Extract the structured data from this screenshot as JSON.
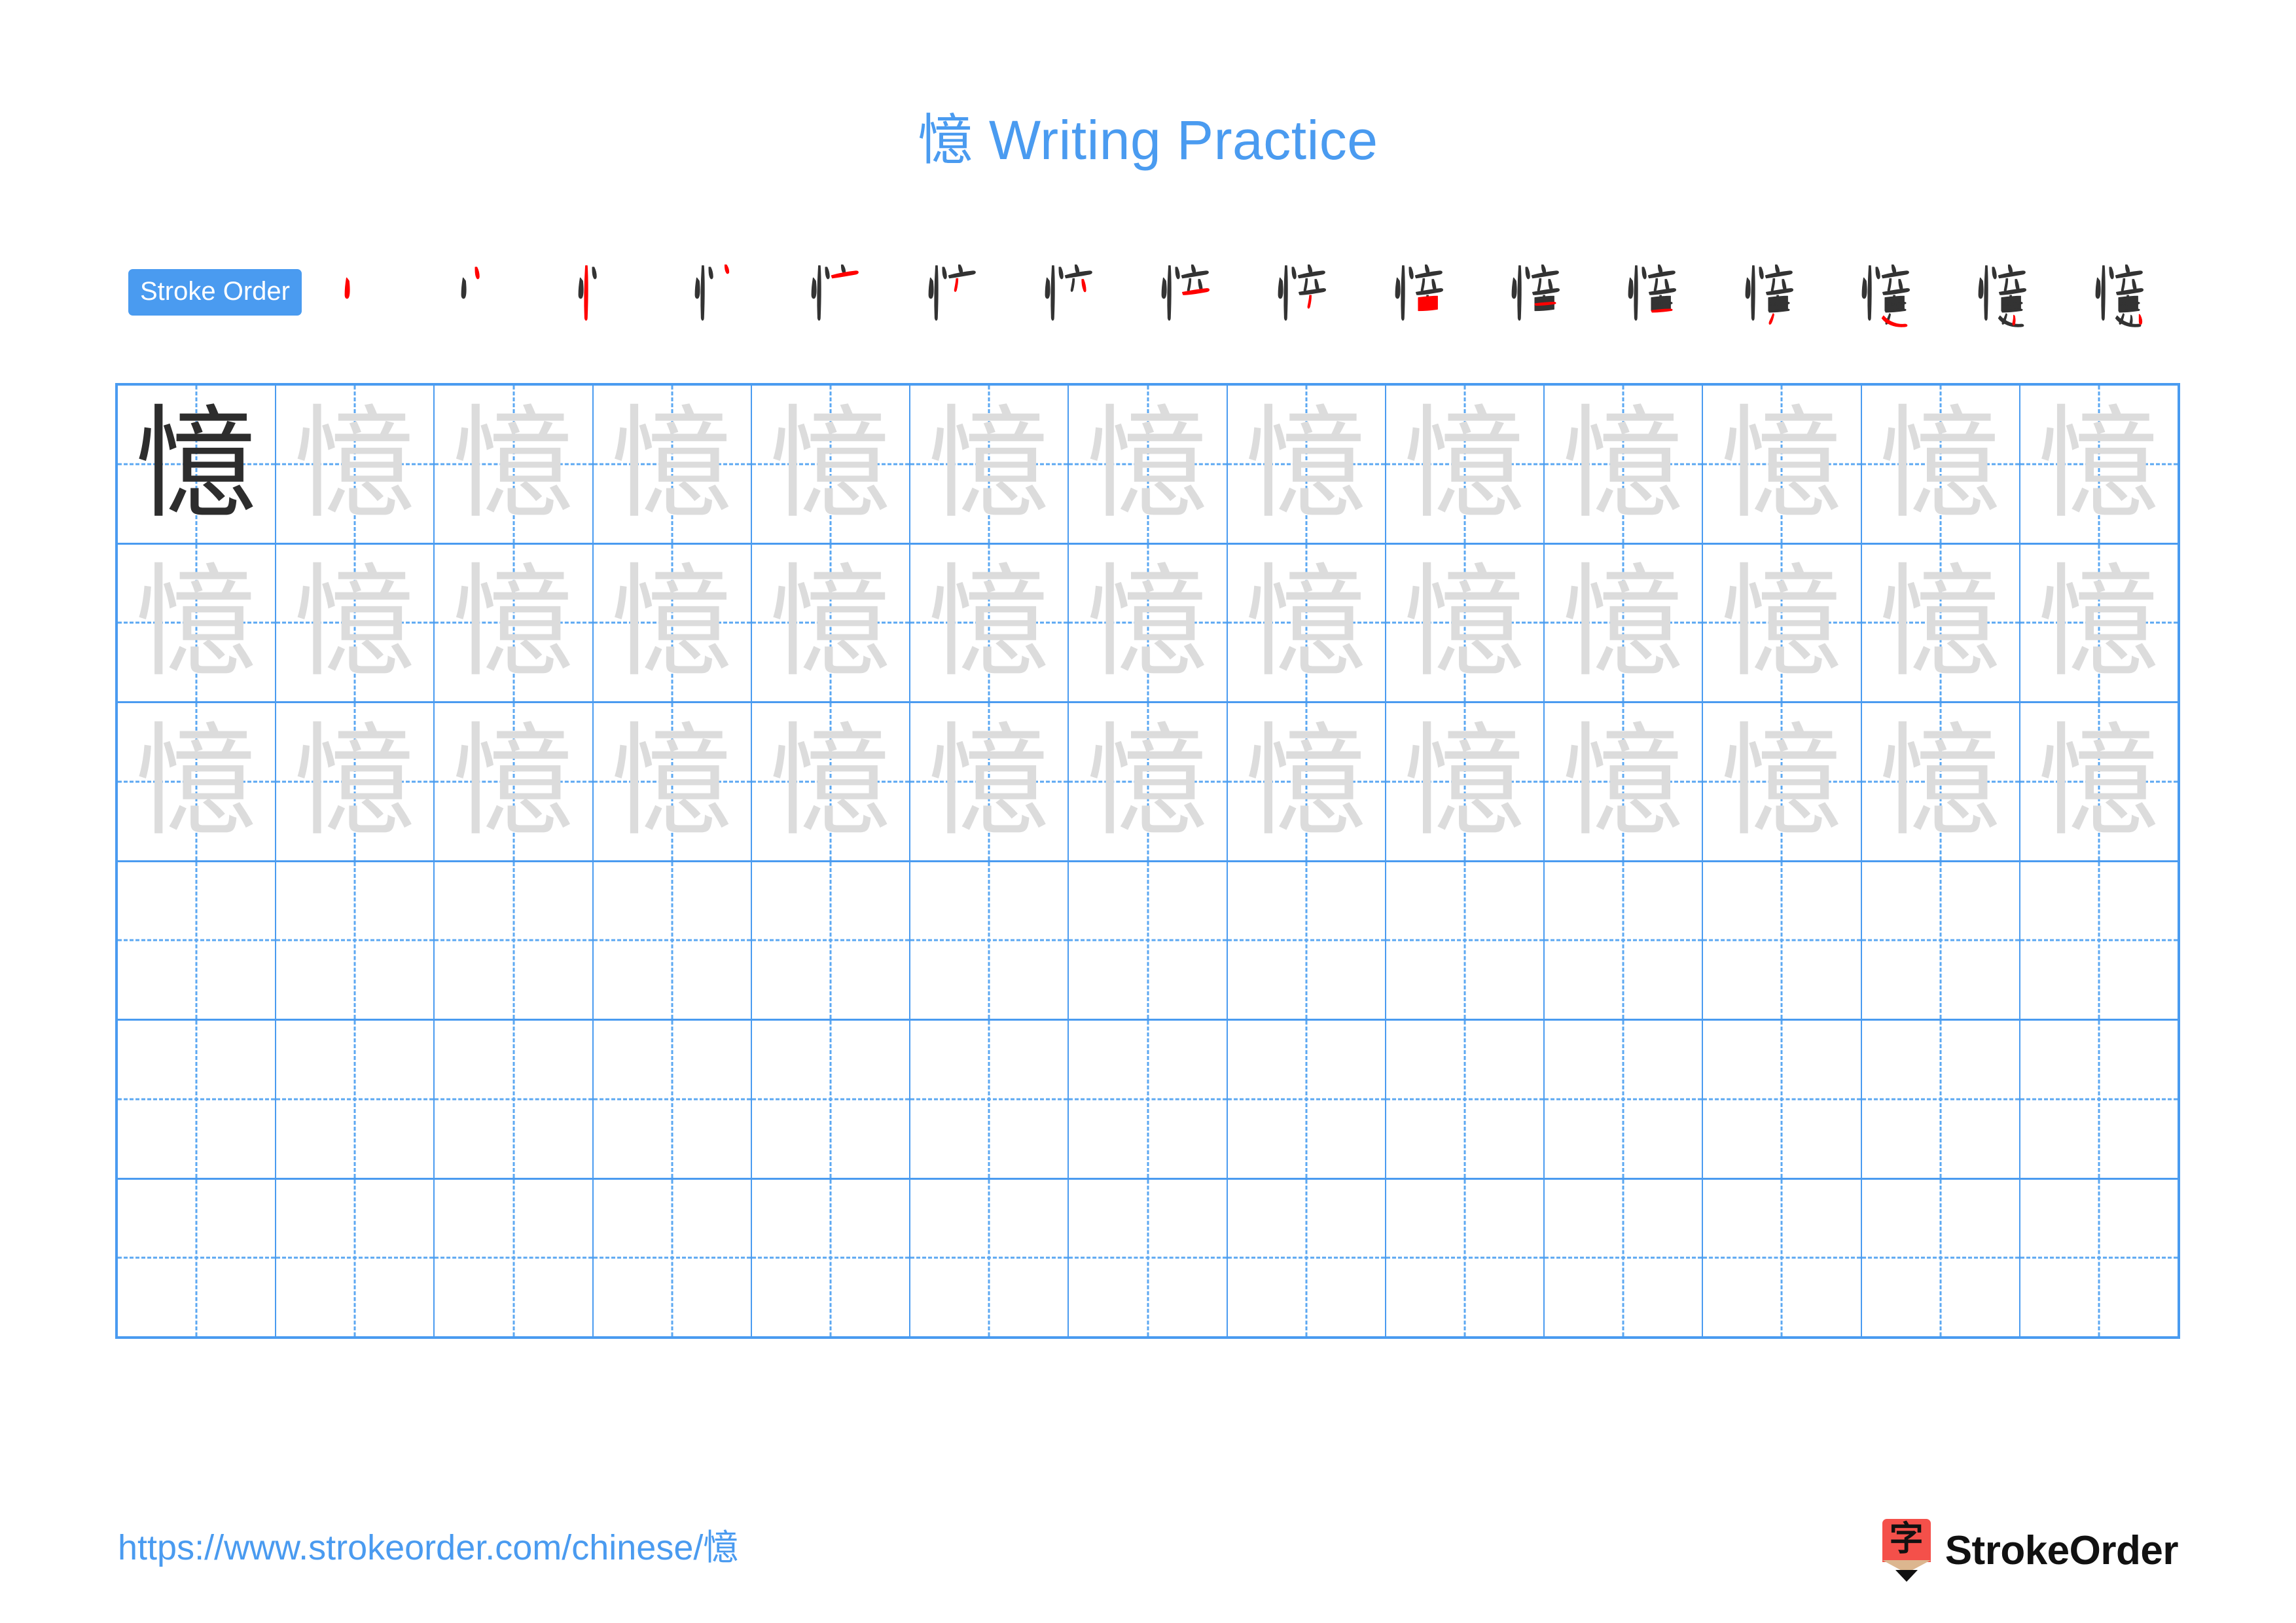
{
  "page": {
    "character": "憶",
    "title": "憶 Writing Practice",
    "title_character": "憶",
    "title_text": " Writing Practice",
    "background_color": "#ffffff",
    "accent_color": "#4a9bf0",
    "trace_color": "#dcdcdc",
    "dark_color": "#2d2d2d",
    "stroke_new_color": "#ff0000",
    "stroke_done_color": "#333333"
  },
  "stroke_order": {
    "label": "Stroke Order",
    "badge_background": "#4a9bf0",
    "badge_text_color": "#ffffff",
    "total_strokes": 16,
    "steps": [
      {
        "index": 1,
        "partial": "丶"
      },
      {
        "index": 2,
        "partial": "丷"
      },
      {
        "index": 3,
        "partial": "忄"
      },
      {
        "index": 4,
        "partial": "忄丶"
      },
      {
        "index": 5,
        "partial": "忄亠"
      },
      {
        "index": 6,
        "partial": "忄亠丶"
      },
      {
        "index": 7,
        "partial": "忄产"
      },
      {
        "index": 8,
        "partial": "忄立"
      },
      {
        "index": 9,
        "partial": "忄竒"
      },
      {
        "index": 10,
        "partial": "忄音"
      },
      {
        "index": 11,
        "partial": "惜"
      },
      {
        "index": 12,
        "partial": "惛"
      },
      {
        "index": 13,
        "partial": "憶"
      },
      {
        "index": 14,
        "partial": "憶"
      },
      {
        "index": 15,
        "partial": "憶"
      },
      {
        "index": 16,
        "partial": "憶"
      }
    ]
  },
  "practice_grid": {
    "columns": 13,
    "rows": 6,
    "grid_line_color": "#4a9bf0",
    "guide_line_color": "#5ca8f2",
    "cells": [
      [
        "dark",
        "trace",
        "trace",
        "trace",
        "trace",
        "trace",
        "trace",
        "trace",
        "trace",
        "trace",
        "trace",
        "trace",
        "trace"
      ],
      [
        "trace",
        "trace",
        "trace",
        "trace",
        "trace",
        "trace",
        "trace",
        "trace",
        "trace",
        "trace",
        "trace",
        "trace",
        "trace"
      ],
      [
        "trace",
        "trace",
        "trace",
        "trace",
        "trace",
        "trace",
        "trace",
        "trace",
        "trace",
        "trace",
        "trace",
        "trace",
        "trace"
      ],
      [
        "blank",
        "blank",
        "blank",
        "blank",
        "blank",
        "blank",
        "blank",
        "blank",
        "blank",
        "blank",
        "blank",
        "blank",
        "blank"
      ],
      [
        "blank",
        "blank",
        "blank",
        "blank",
        "blank",
        "blank",
        "blank",
        "blank",
        "blank",
        "blank",
        "blank",
        "blank",
        "blank"
      ],
      [
        "blank",
        "blank",
        "blank",
        "blank",
        "blank",
        "blank",
        "blank",
        "blank",
        "blank",
        "blank",
        "blank",
        "blank",
        "blank"
      ]
    ]
  },
  "footer": {
    "url": "https://www.strokeorder.com/chinese/憶",
    "brand_name": "StrokeOrder",
    "logo_character": "字",
    "logo_body_color": "#f4504a",
    "logo_wood_color": "#dcb68f",
    "logo_tip_color": "#111111"
  }
}
